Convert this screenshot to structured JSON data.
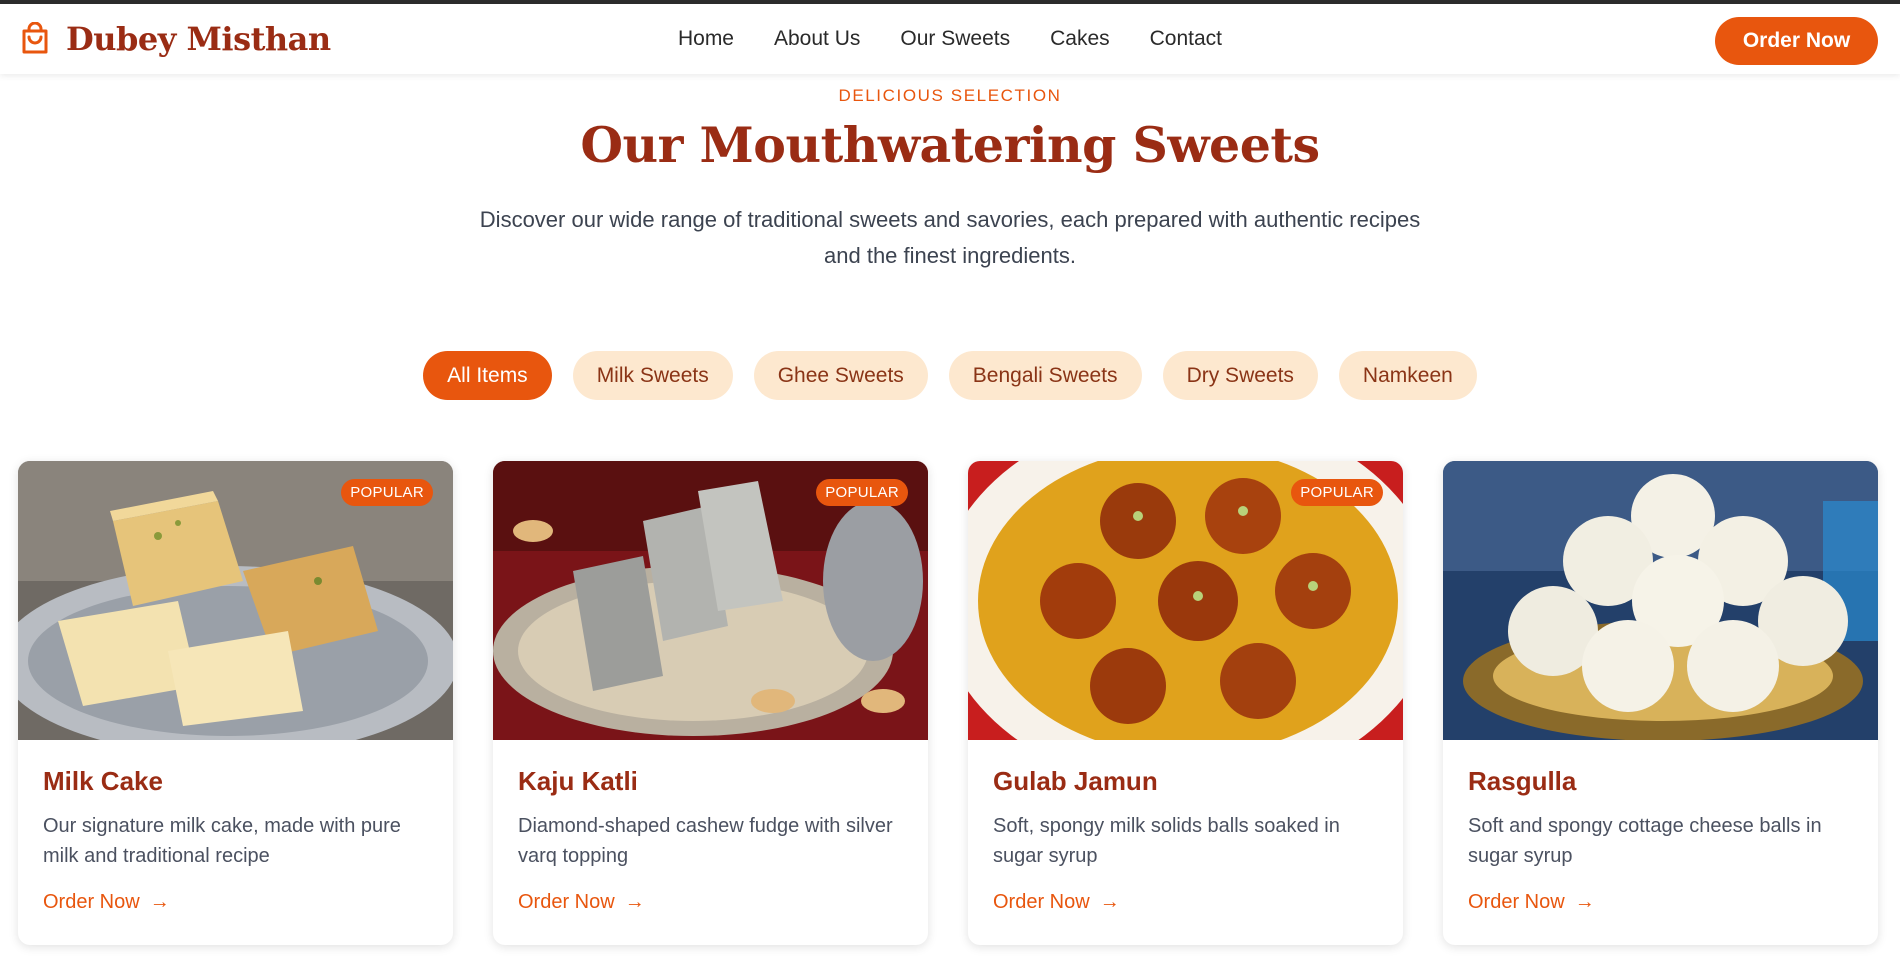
{
  "header": {
    "brand": "Dubey Misthan",
    "brand_icon": "shopping-bag-icon",
    "nav": [
      "Home",
      "About Us",
      "Our Sweets",
      "Cakes",
      "Contact"
    ],
    "order_button": "Order Now"
  },
  "hero": {
    "eyebrow": "DELICIOUS SELECTION",
    "title": "Our Mouthwatering Sweets",
    "subtitle": "Discover our wide range of traditional sweets and savories, each prepared with authentic recipes and the finest ingredients."
  },
  "filters": {
    "items": [
      "All Items",
      "Milk Sweets",
      "Ghee Sweets",
      "Bengali Sweets",
      "Dry Sweets",
      "Namkeen"
    ],
    "active": "All Items"
  },
  "products": [
    {
      "name": "Milk Cake",
      "description": "Our signature milk cake, made with pure milk and traditional recipe",
      "badge": "POPULAR",
      "link": "Order Now"
    },
    {
      "name": "Kaju Katli",
      "description": "Diamond-shaped cashew fudge with silver varq topping",
      "badge": "POPULAR",
      "link": "Order Now"
    },
    {
      "name": "Gulab Jamun",
      "description": "Soft, spongy milk solids balls soaked in sugar syrup",
      "badge": "POPULAR",
      "link": "Order Now"
    },
    {
      "name": "Rasgulla",
      "description": "Soft and spongy cottage cheese balls in sugar syrup",
      "badge": "",
      "link": "Order Now"
    }
  ],
  "colors": {
    "accent": "#e8560e",
    "brand": "#9a2c14",
    "chip": "#fde8cf"
  }
}
